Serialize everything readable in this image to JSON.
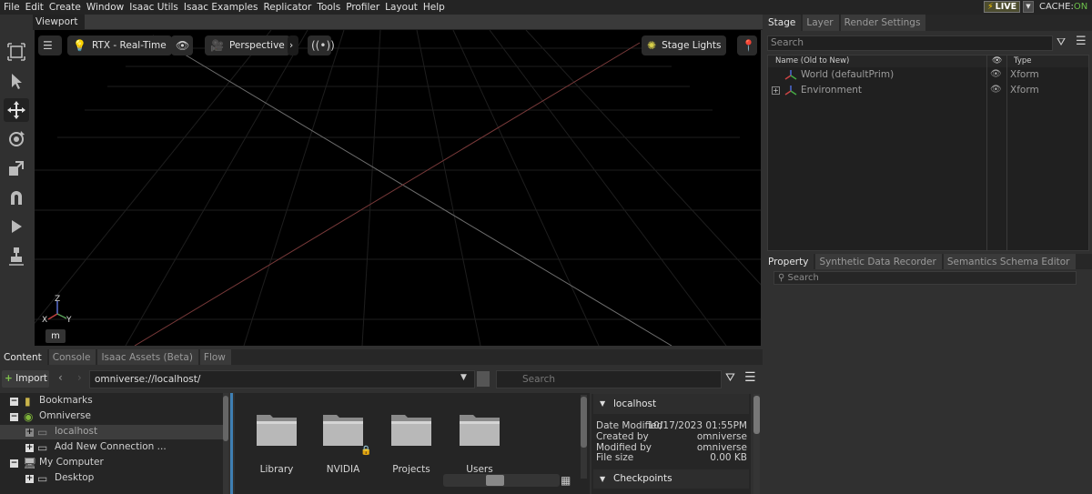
{
  "menu": [
    "File",
    "Edit",
    "Create",
    "Window",
    "Isaac Utils",
    "Isaac Examples",
    "Replicator",
    "Tools",
    "Profiler",
    "Layout",
    "Help"
  ],
  "status": {
    "live_label": "LIVE",
    "cache_label": "CACHE:",
    "cache_state": "ON"
  },
  "viewport": {
    "tab": "Viewport",
    "render_mode": "RTX - Real-Time",
    "camera": "Perspective",
    "lights": "Stage Lights",
    "axis_z": "Z",
    "axis_x": "X",
    "axis_y": "Y",
    "units_button": "m"
  },
  "stage": {
    "tabs": [
      "Stage",
      "Layer",
      "Render Settings"
    ],
    "search_placeholder": "Search",
    "columns": {
      "name": "Name (Old to New)",
      "type": "Type"
    },
    "rows": [
      {
        "name": "World (defaultPrim)",
        "type": "Xform"
      },
      {
        "name": "Environment",
        "type": "Xform"
      }
    ]
  },
  "property": {
    "tabs": [
      "Property",
      "Synthetic Data Recorder",
      "Semantics Schema Editor"
    ],
    "search_placeholder": "Search"
  },
  "content": {
    "tabs": [
      "Content",
      "Console",
      "Isaac Assets (Beta)",
      "Flow"
    ],
    "import_label": "Import",
    "path": "omniverse://localhost/",
    "search_placeholder": "Search",
    "tree": [
      {
        "label": "Bookmarks"
      },
      {
        "label": "Omniverse"
      },
      {
        "label": "localhost"
      },
      {
        "label": "Add New Connection ..."
      },
      {
        "label": "My Computer"
      },
      {
        "label": "Desktop"
      }
    ],
    "folders": [
      "Library",
      "NVIDIA",
      "Projects",
      "Users"
    ],
    "details": {
      "title": "localhost",
      "date_modified_label": "Date Modified",
      "date_modified": "10/17/2023 01:55PM",
      "created_by_label": "Created by",
      "created_by": "omniverse",
      "modified_by_label": "Modified by",
      "modified_by": "omniverse",
      "file_size_label": "File size",
      "file_size": "0.00 KB",
      "checkpoints": "Checkpoints"
    }
  }
}
